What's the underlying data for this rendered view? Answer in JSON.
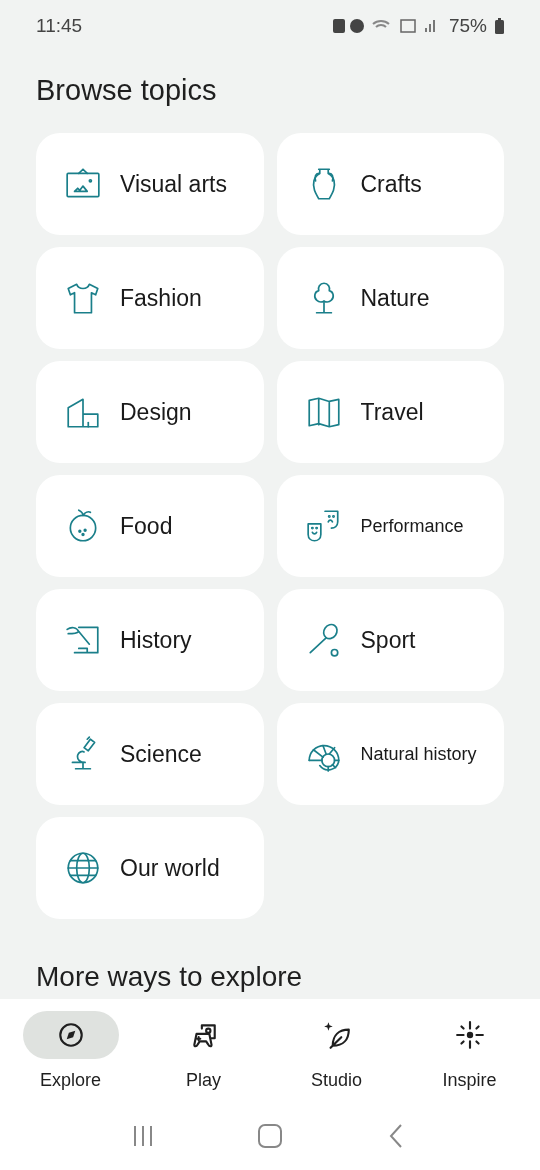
{
  "status_bar": {
    "time": "11:45",
    "battery": "75%"
  },
  "title": "Browse topics",
  "topics": [
    {
      "label": "Visual arts",
      "kind": "regular"
    },
    {
      "label": "Crafts",
      "kind": "regular"
    },
    {
      "label": "Fashion",
      "kind": "regular"
    },
    {
      "label": "Nature",
      "kind": "regular"
    },
    {
      "label": "Design",
      "kind": "regular"
    },
    {
      "label": "Travel",
      "kind": "regular"
    },
    {
      "label": "Food",
      "kind": "regular"
    },
    {
      "label": "Performance",
      "kind": "compact"
    },
    {
      "label": "History",
      "kind": "regular"
    },
    {
      "label": "Sport",
      "kind": "regular"
    },
    {
      "label": "Science",
      "kind": "regular"
    },
    {
      "label": "Natural history",
      "kind": "compact"
    },
    {
      "label": "Our world",
      "kind": "regular"
    }
  ],
  "section_title": "More ways to explore",
  "nav": [
    {
      "label": "Explore",
      "selected": true
    },
    {
      "label": "Play",
      "selected": false
    },
    {
      "label": "Studio",
      "selected": false
    },
    {
      "label": "Inspire",
      "selected": false
    }
  ]
}
